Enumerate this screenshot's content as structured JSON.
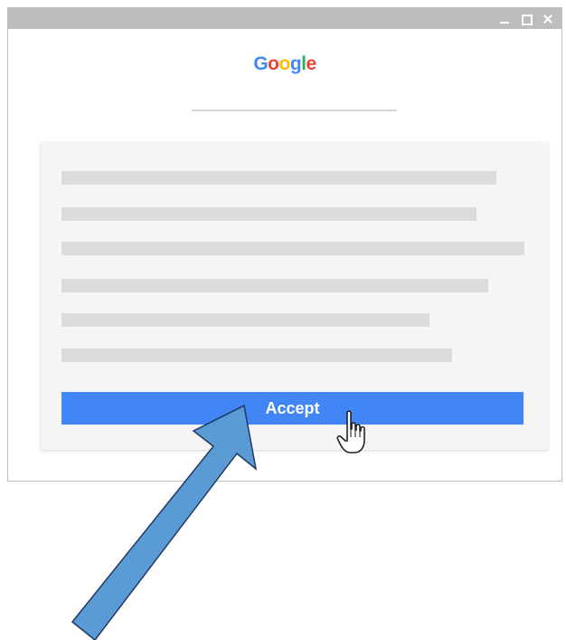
{
  "window": {
    "controls": {
      "minimize_icon": "minimize-icon",
      "maximize_icon": "maximize-icon",
      "close_icon": "close-icon"
    }
  },
  "logo": {
    "letters": [
      {
        "char": "G",
        "color": "#4285f4"
      },
      {
        "char": "o",
        "color": "#ea4335"
      },
      {
        "char": "o",
        "color": "#fbbc05"
      },
      {
        "char": "g",
        "color": "#4285f4"
      },
      {
        "char": "l",
        "color": "#34a853"
      },
      {
        "char": "e",
        "color": "#ea4335"
      }
    ]
  },
  "dialog": {
    "accept_label": "Accept"
  },
  "colors": {
    "accent": "#4285f4",
    "titlebar": "#bdbdbd",
    "placeholder_line": "#dcdcdc",
    "card_bg": "#f5f5f5",
    "annotation_arrow": "#5b9bd5"
  },
  "icons": {
    "cursor": "hand-pointer-icon",
    "annotation": "arrow-icon"
  }
}
